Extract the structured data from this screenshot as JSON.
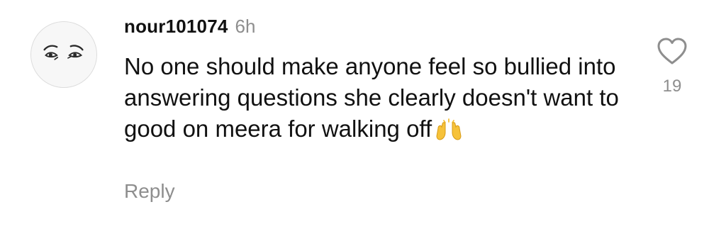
{
  "comment": {
    "username": "nour101074",
    "timestamp": "6h",
    "text": "No one should make anyone feel so bullied into answering questions she clearly doesn't want to good on meera for walking off",
    "emoji": "raising-hands-emoji",
    "reply_label": "Reply",
    "like_count": "19"
  },
  "icons": {
    "like": "heart-outline-icon",
    "avatar": "face-sketch-avatar"
  },
  "colors": {
    "text": "#111111",
    "muted": "#8e8e8e",
    "emoji": "#f6c23a"
  }
}
